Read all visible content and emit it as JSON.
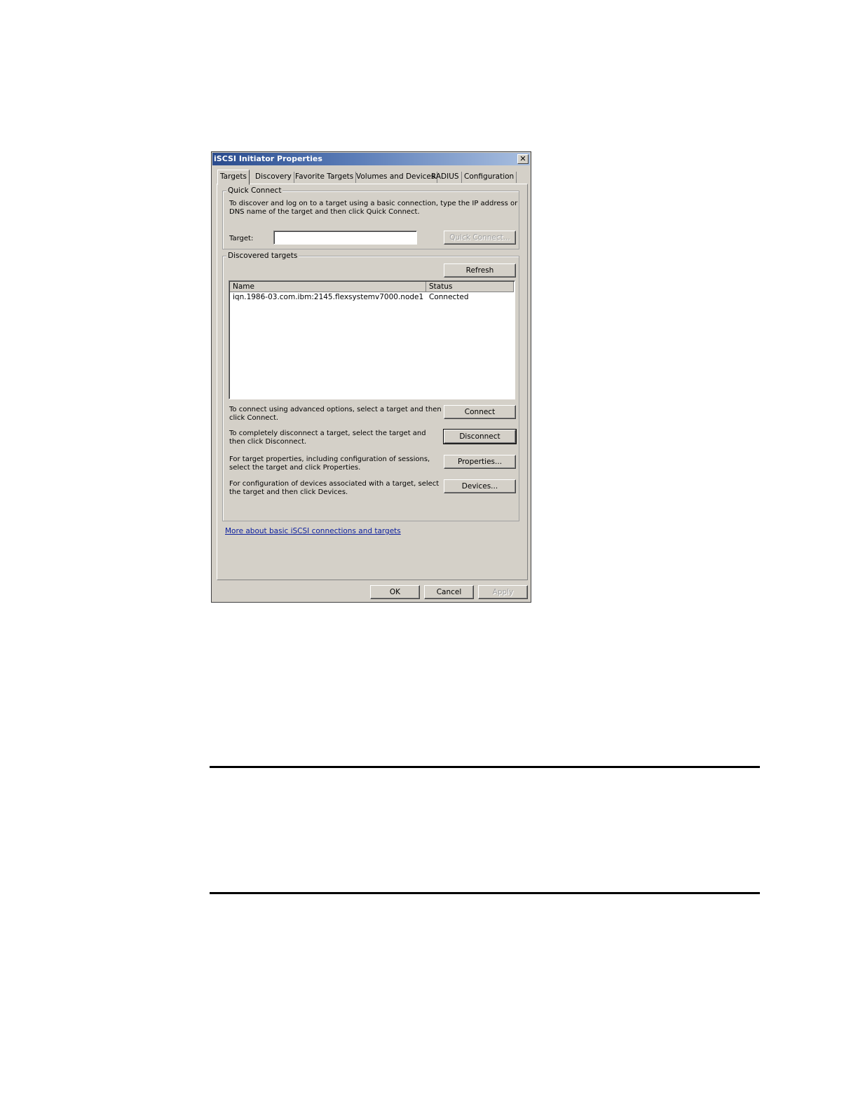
{
  "dialog": {
    "title": "iSCSI Initiator Properties",
    "close_glyph": "✕",
    "tabs": [
      {
        "label": "Targets"
      },
      {
        "label": "Discovery"
      },
      {
        "label": "Favorite Targets"
      },
      {
        "label": "Volumes and Devices"
      },
      {
        "label": "RADIUS"
      },
      {
        "label": "Configuration"
      }
    ],
    "active_tab": "Targets",
    "quick_connect": {
      "legend": "Quick Connect",
      "description_line1": "To discover and log on to a target using a basic connection, type the IP address or",
      "description_line2": "DNS name of the target and then click Quick Connect.",
      "target_label": "Target:",
      "target_value": "",
      "button": "Quick Connect..."
    },
    "discovered": {
      "legend": "Discovered targets",
      "refresh_button": "Refresh",
      "columns": [
        "Name",
        "Status"
      ],
      "rows": [
        {
          "name": "iqn.1986-03.com.ibm:2145.flexsystemv7000.node1",
          "status": "Connected"
        }
      ],
      "connect_text_line1": "To connect using advanced options, select a target and then",
      "connect_text_line2": "click Connect.",
      "connect_button": "Connect",
      "disconnect_text_line1": "To completely disconnect a target, select the target and",
      "disconnect_text_line2": "then click Disconnect.",
      "disconnect_button": "Disconnect",
      "properties_text_line1": "For target properties, including configuration of sessions,",
      "properties_text_line2": "select the target and click Properties.",
      "properties_button": "Properties...",
      "devices_text_line1": "For configuration of devices associated with a target, select",
      "devices_text_line2": "the target and then click Devices.",
      "devices_button": "Devices..."
    },
    "help_link": "More about basic iSCSI connections and targets",
    "footer": {
      "ok": "OK",
      "cancel": "Cancel",
      "apply": "Apply"
    }
  }
}
